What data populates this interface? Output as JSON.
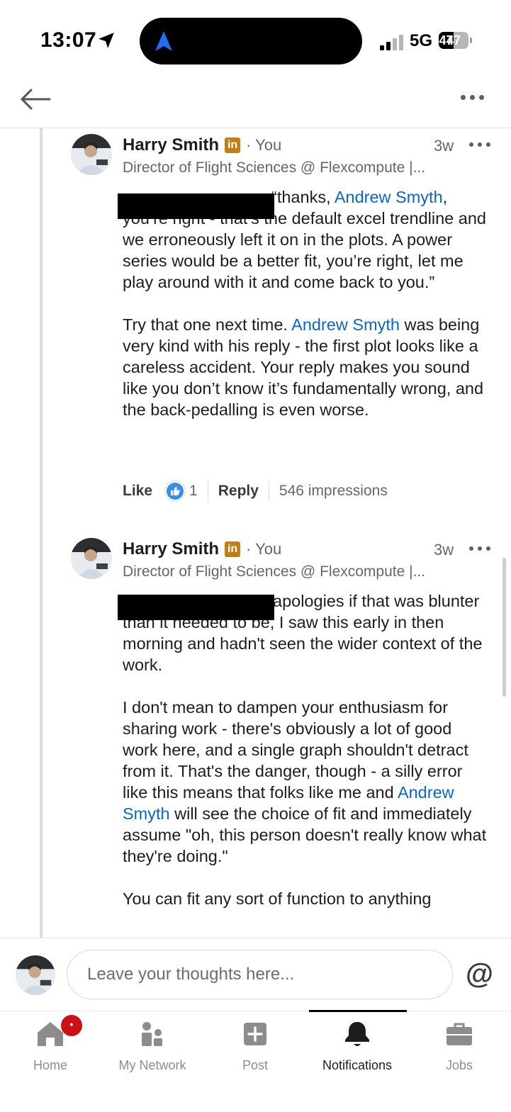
{
  "status_bar": {
    "time": "13:07",
    "network": "5G",
    "battery": "47"
  },
  "comments": [
    {
      "author": "Harry Smith",
      "linkedin_badge": "in",
      "you_label": "You",
      "age": "3w",
      "headline": "Director of Flight Sciences @ Flexcompute |...",
      "body_p1_start": "“thanks, ",
      "mention_1": "Andrew Smyth",
      "body_p1_rest": ", you’re right - that’s the default excel trendline and we erroneously left it on in the plots. A power series would be a better fit, you’re right, let me play around with it and come back to you.”",
      "body_p2_start": "Try that one next time. ",
      "mention_2": "Andrew Smyth",
      "body_p2_rest": " was being very kind with his reply - the first plot looks like a careless accident. Your reply makes you sound like you don’t know it’s fundamentally wrong, and the back-pedalling is  even worse.",
      "like_label": "Like",
      "like_count": "1",
      "reply_label": "Reply",
      "impressions": "546 impressions"
    },
    {
      "author": "Harry Smith",
      "linkedin_badge": "in",
      "you_label": "You",
      "age": "3w",
      "headline": "Director of Flight Sciences @ Flexcompute |...",
      "body_p1": "apologies if that was blunter than it needed to be, I saw this early in then morning and hadn't seen the wider context of the work.",
      "body_p2_start": "I don't mean to dampen your enthusiasm for sharing work - there's obviously a lot of good work here, and a single graph shouldn't detract from it. That's the danger, though - a silly error like this means that folks like me and ",
      "mention_1": "Andrew Smyth",
      "body_p2_rest": " will see the choice of fit and immediately assume \"oh, this person doesn't really know what they're doing.\"",
      "body_p3": "You can fit any sort of function to anything"
    }
  ],
  "composer": {
    "placeholder": "Leave your thoughts here...",
    "mention_symbol": "@"
  },
  "tabs": [
    {
      "label": "Home",
      "icon": "home-icon"
    },
    {
      "label": "My Network",
      "icon": "network-icon"
    },
    {
      "label": "Post",
      "icon": "post-icon"
    },
    {
      "label": "Notifications",
      "icon": "bell-icon"
    },
    {
      "label": "Jobs",
      "icon": "briefcase-icon"
    }
  ],
  "home_badge": "•",
  "active_tab": "Notifications"
}
